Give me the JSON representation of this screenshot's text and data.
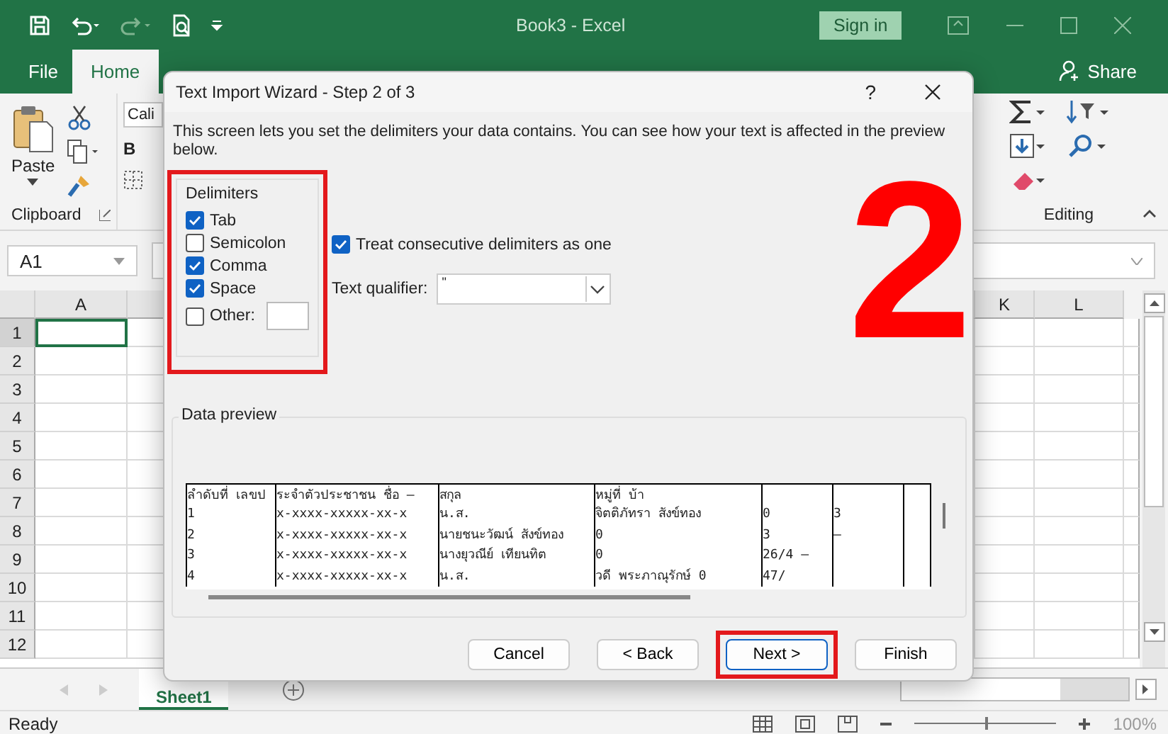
{
  "window": {
    "title": "Book3  -  Excel",
    "sign_in": "Sign in"
  },
  "ribbon_tabs": [
    {
      "label": "File",
      "selected": false
    },
    {
      "label": "Home",
      "selected": true
    }
  ],
  "share": "Share",
  "ribbon": {
    "paste": "Paste",
    "clipboard_group": "Clipboard",
    "font_box": "Cali",
    "bold": "B",
    "editing_group": "Editing"
  },
  "name_box": "A1",
  "columns": [
    "A",
    "K",
    "L"
  ],
  "rows": [
    "1",
    "2",
    "3",
    "4",
    "5",
    "6",
    "7",
    "8",
    "9",
    "10",
    "11",
    "12"
  ],
  "sheet_tabs": [
    {
      "label": "Sheet1",
      "selected": true
    }
  ],
  "status_bar": {
    "text": "Ready",
    "zoom": {
      "level": 0.5,
      "reading": "100%"
    }
  },
  "dialog": {
    "title": "Text Import Wizard - Step 2 of 3",
    "help": "?",
    "description": "This screen lets you set the delimiters your data contains.  You can see how your text is affected in the preview below.",
    "delimiters": {
      "title": "Delimiters",
      "highlighted": true,
      "options": [
        {
          "label": "Tab",
          "checked": true,
          "kind": "plain"
        },
        {
          "label": "Semicolon",
          "checked": false,
          "kind": "plain"
        },
        {
          "label": "Comma",
          "checked": true,
          "kind": "plain"
        },
        {
          "label": "Space",
          "checked": true,
          "kind": "plain"
        },
        {
          "label": "Other:",
          "checked": false,
          "kind": "with_field"
        }
      ]
    },
    "consecutive": {
      "label": "Treat consecutive delimiters as one",
      "checked": true
    },
    "qualifier": {
      "label": "Text qualifier:",
      "value": "\""
    },
    "step_marker": "2",
    "preview": {
      "title": "Data preview",
      "rows": [
        [
          "ลำดับที่ เลขป",
          "ระจำตัวประชาชน ชื่อ  –",
          "สกุล",
          "หมู่ที่ บ้า",
          "",
          "",
          ""
        ],
        [
          "1",
          "x-xxxx-xxxxx-xx-x",
          "น.ส.",
          "จิตติภัทรา สังข์ทอง",
          "0",
          "3",
          ""
        ],
        [
          "2",
          "x-xxxx-xxxxx-xx-x",
          "นายชนะวัฒน์ สังข์ทอง",
          "0",
          "3",
          "–",
          ""
        ],
        [
          "3",
          "x-xxxx-xxxxx-xx-x",
          "นางยุวณีย์ เทียนทิต",
          "0",
          "26/4 –",
          "",
          ""
        ],
        [
          "4",
          "x-xxxx-xxxxx-xx-x",
          "น.ส.",
          "วดี พระภาณุรักษ์ 0",
          "47/",
          "",
          ""
        ]
      ]
    },
    "buttons": [
      {
        "label": "Cancel",
        "highlighted": false,
        "focused": false
      },
      {
        "label": "< Back",
        "highlighted": false,
        "focused": false
      },
      {
        "label": "Next >",
        "highlighted": true,
        "focused": true
      },
      {
        "label": "Finish",
        "highlighted": false,
        "focused": false
      }
    ]
  }
}
